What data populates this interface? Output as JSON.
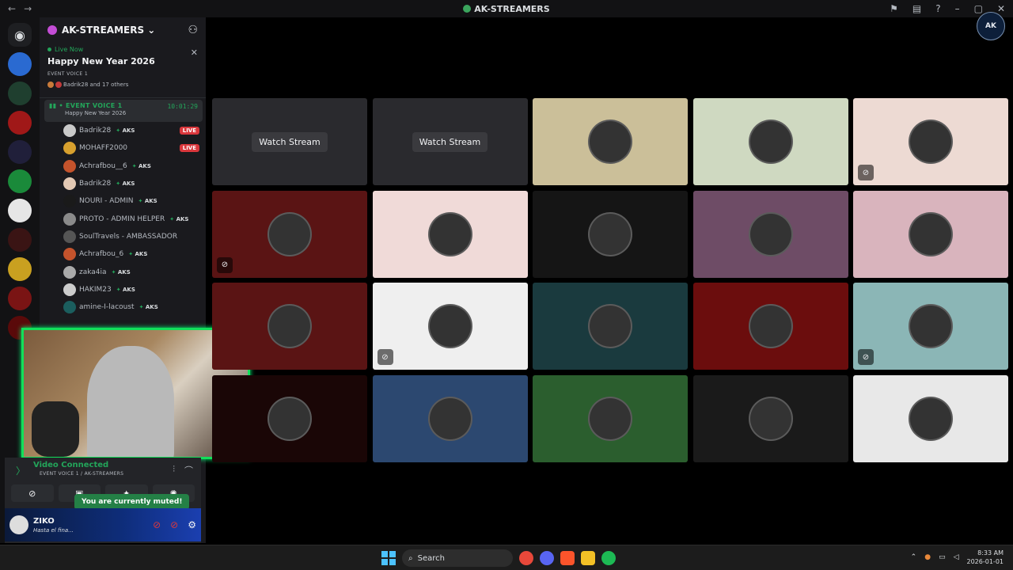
{
  "window": {
    "title": "AK-STREAMERS"
  },
  "server": {
    "name": "AK-STREAMERS"
  },
  "event": {
    "status": "Live Now",
    "title": "Happy New Year 2026",
    "channel": "EVENT VOICE 1",
    "attendees": "Badrik28 and 17 others"
  },
  "voice_channel": {
    "name": "EVENT VOICE 1",
    "subtitle": "Happy New Year 2026",
    "timer": "10:01:29"
  },
  "members": [
    {
      "name": "Badrik28",
      "tag": "AKS",
      "live": "LIVE"
    },
    {
      "name": "MOHAFF2000",
      "tag": "",
      "live": "LIVE"
    },
    {
      "name": "Achrafbou__6",
      "tag": "AKS",
      "live": ""
    },
    {
      "name": "Badrik28",
      "tag": "AKS",
      "live": ""
    },
    {
      "name": "NOURI - ADMIN",
      "tag": "AKS",
      "live": ""
    },
    {
      "name": "PROTO - ADMIN HELPER",
      "tag": "AKS",
      "live": ""
    },
    {
      "name": "SoulTravels - AMBASSADOR",
      "tag": "",
      "live": ""
    },
    {
      "name": "Achrafbou_6",
      "tag": "AKS",
      "live": ""
    },
    {
      "name": "zaka4ia",
      "tag": "AKS",
      "live": ""
    },
    {
      "name": "HAKIM23",
      "tag": "AKS",
      "live": ""
    },
    {
      "name": "amine-I-lacoust",
      "tag": "AKS",
      "live": ""
    }
  ],
  "voice_status": {
    "status": "Video Connected",
    "location": "EVENT VOICE 1 / AK-STREAMERS"
  },
  "toast": "You are currently muted!",
  "user": {
    "name": "ZIKO",
    "status": "Hasta el fina..."
  },
  "grid": {
    "watch_label": "Watch Stream",
    "tiles": [
      {
        "color": "#2a2a2e",
        "kind": "watch",
        "muted": false
      },
      {
        "color": "#2a2a2e",
        "kind": "watch",
        "muted": false
      },
      {
        "color": "#cbbf99",
        "kind": "avatar",
        "muted": false
      },
      {
        "color": "#cfd9c1",
        "kind": "avatar",
        "muted": false
      },
      {
        "color": "#eddad3",
        "kind": "avatar",
        "muted": true
      },
      {
        "color": "#5a1414",
        "kind": "avatar",
        "muted": true
      },
      {
        "color": "#f0dad8",
        "kind": "avatar",
        "muted": false
      },
      {
        "color": "#151515",
        "kind": "avatar",
        "muted": false
      },
      {
        "color": "#6e4c66",
        "kind": "avatar",
        "muted": false
      },
      {
        "color": "#d9b4bd",
        "kind": "avatar",
        "muted": false
      },
      {
        "color": "#5a1414",
        "kind": "avatar",
        "muted": false
      },
      {
        "color": "#efefef",
        "kind": "avatar",
        "muted": true
      },
      {
        "color": "#1a3a3e",
        "kind": "avatar",
        "muted": false
      },
      {
        "color": "#6b0d0d",
        "kind": "avatar",
        "muted": false
      },
      {
        "color": "#8bb6b6",
        "kind": "avatar",
        "muted": true
      },
      {
        "color": "#1a0606",
        "kind": "avatar",
        "muted": false
      },
      {
        "color": "#2c4870",
        "kind": "avatar",
        "muted": false
      },
      {
        "color": "#2b5e2e",
        "kind": "avatar",
        "muted": false
      },
      {
        "color": "#1a1a1a",
        "kind": "avatar",
        "muted": false
      },
      {
        "color": "#e8e8e8",
        "kind": "avatar",
        "muted": false
      }
    ]
  },
  "taskbar": {
    "search": "Search",
    "time": "8:33 AM",
    "date": "2026-01-01"
  }
}
